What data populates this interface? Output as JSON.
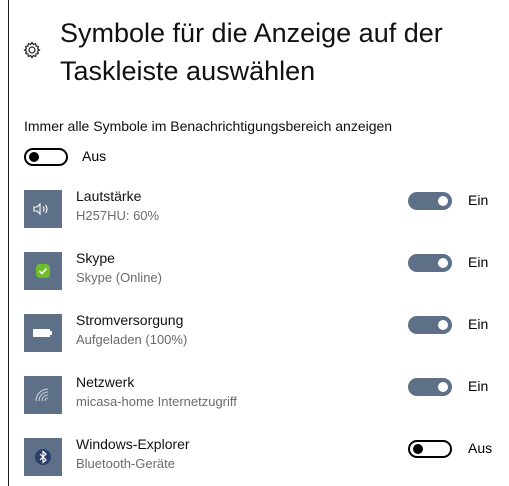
{
  "header": {
    "title": "Symbole für die Anzeige auf der Taskleiste auswählen"
  },
  "master": {
    "label": "Immer alle Symbole im Benachrichtigungsbereich anzeigen",
    "state": "Aus"
  },
  "items": [
    {
      "name": "Lautstärke",
      "sub": "H257HU: 60%",
      "state": "Ein",
      "icon": "speaker-icon"
    },
    {
      "name": "Skype",
      "sub": "Skype (Online)",
      "state": "Ein",
      "icon": "skype-icon"
    },
    {
      "name": "Stromversorgung",
      "sub": "Aufgeladen (100%)",
      "state": "Ein",
      "icon": "battery-icon"
    },
    {
      "name": "Netzwerk",
      "sub": "micasa-home Internetzugriff",
      "state": "Ein",
      "icon": "wifi-icon"
    },
    {
      "name": "Windows-Explorer",
      "sub": "Bluetooth-Geräte",
      "state": "Aus",
      "icon": "bluetooth-icon"
    }
  ],
  "colors": {
    "accent": "#5e6f88",
    "skype_green": "#6cbf2a",
    "subtext": "#6b6b6b"
  }
}
